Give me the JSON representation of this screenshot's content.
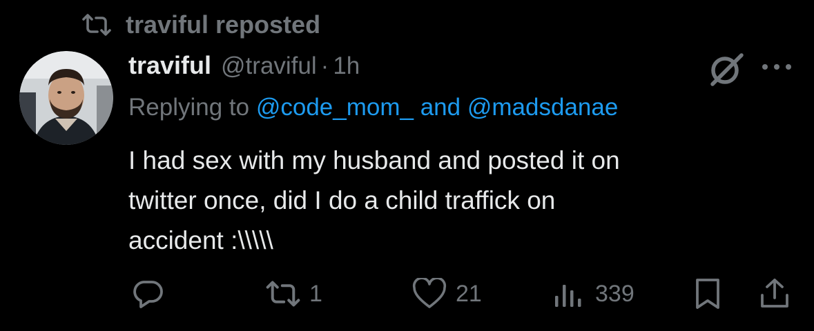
{
  "repost": {
    "label": "traviful reposted",
    "icon": "repost-icon"
  },
  "tweet": {
    "author": {
      "display_name": "traviful",
      "handle": "@traviful",
      "separator": "·",
      "time": "1h",
      "avatar": "avatar"
    },
    "reply_context": {
      "prefix": "Replying to",
      "mention_1": "@code_mom_",
      "conjunction": "and",
      "mention_2": "@madsdanae"
    },
    "text": "I had sex with my husband and posted it on\ntwitter once, did I do a child traffick on\naccident :\\\\\\\\\\"
  },
  "actions": {
    "reply": {
      "icon": "reply-icon"
    },
    "repost": {
      "icon": "repost-icon",
      "count": "1"
    },
    "like": {
      "icon": "heart-icon",
      "count": "21"
    },
    "views": {
      "icon": "views-icon",
      "count": "339"
    },
    "bookmark": {
      "icon": "bookmark-icon"
    },
    "share": {
      "icon": "share-icon"
    }
  },
  "colors": {
    "background": "#000000",
    "text": "#e7e9ea",
    "muted": "#71767b",
    "link": "#1d9bf0"
  }
}
